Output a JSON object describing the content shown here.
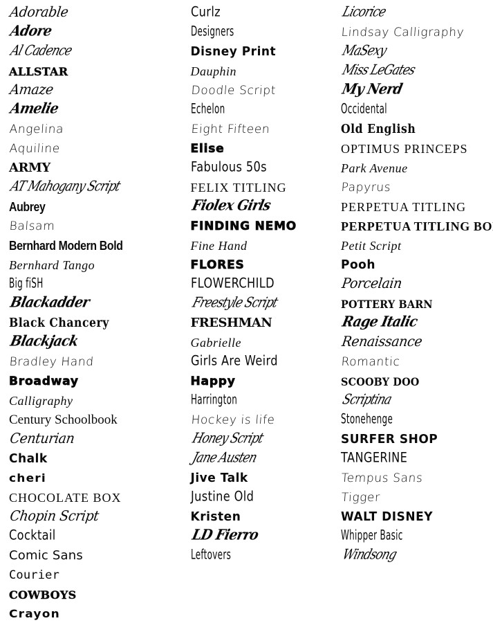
{
  "document": {
    "type": "font-specimen-sheet",
    "background_color": "#ffffff",
    "text_color": "#000000",
    "column_count": 3
  },
  "columns": [
    {
      "name": "column-1",
      "samples": [
        {
          "label": "Adorable",
          "style": "s-script"
        },
        {
          "label": "Adore",
          "style": "s-swash"
        },
        {
          "label": "Al Cadence",
          "style": "s-signature"
        },
        {
          "label": "ALLSTAR",
          "style": "s-western"
        },
        {
          "label": "Amaze",
          "style": "s-script"
        },
        {
          "label": "Amelie",
          "style": "s-swash"
        },
        {
          "label": "Angelina",
          "style": "s-hand"
        },
        {
          "label": "Aquiline",
          "style": "s-hand"
        },
        {
          "label": "ARMY",
          "style": "s-slab"
        },
        {
          "label": "AT Mahogany Script",
          "style": "s-signature"
        },
        {
          "label": "Aubrey",
          "style": "s-poster"
        },
        {
          "label": "Balsam",
          "style": "s-hand"
        },
        {
          "label": "Bernhard Modern Bold",
          "style": "s-poster"
        },
        {
          "label": "Bernhard Tango",
          "style": "s-thinitalic"
        },
        {
          "label": "Big fiSH",
          "style": "s-narrow"
        },
        {
          "label": "Blackadder",
          "style": "s-swash"
        },
        {
          "label": "Black Chancery",
          "style": "s-blackletter"
        },
        {
          "label": "Blackjack",
          "style": "s-swash"
        },
        {
          "label": "Bradley Hand",
          "style": "s-hand"
        },
        {
          "label": "Broadway",
          "style": "s-fat"
        },
        {
          "label": "Calligraphy",
          "style": "s-thinitalic"
        },
        {
          "label": "Century Schoolbook",
          "style": "s-serif"
        },
        {
          "label": "Centurian",
          "style": "s-script"
        },
        {
          "label": "Chalk",
          "style": "s-marker"
        },
        {
          "label": "cheri",
          "style": "s-crayon"
        },
        {
          "label": "Chocolate Box",
          "style": "s-titling"
        },
        {
          "label": "Chopin Script",
          "style": "s-script"
        },
        {
          "label": "Cocktail",
          "style": "s-whimsy"
        },
        {
          "label": "Comic Sans",
          "style": "s-sans"
        },
        {
          "label": "Courier",
          "style": "s-mono"
        },
        {
          "label": "COWBOYS",
          "style": "s-western"
        },
        {
          "label": "Crayon",
          "style": "s-crayon"
        }
      ]
    },
    {
      "name": "column-2",
      "samples": [
        {
          "label": "Curlz",
          "style": "s-whimsy"
        },
        {
          "label": "Designers",
          "style": "s-narrow"
        },
        {
          "label": "Disney Print",
          "style": "s-marker"
        },
        {
          "label": "Dauphin",
          "style": "s-thinitalic"
        },
        {
          "label": "Doodle Script",
          "style": "s-hand"
        },
        {
          "label": "Echelon",
          "style": "s-narrow"
        },
        {
          "label": "Eight Fifteen",
          "style": "s-hand"
        },
        {
          "label": "Elise",
          "style": "s-fat"
        },
        {
          "label": "Fabulous 50s",
          "style": "s-whimsy"
        },
        {
          "label": "FELIX TITLING",
          "style": "s-titling"
        },
        {
          "label": "Fiolex Girls",
          "style": "s-swash"
        },
        {
          "label": "FINDING NEMO",
          "style": "s-fat"
        },
        {
          "label": "Fine Hand",
          "style": "s-thinitalic"
        },
        {
          "label": "FLORES",
          "style": "s-fat"
        },
        {
          "label": "FLOWERCHILD",
          "style": "s-whimsy"
        },
        {
          "label": "Freestyle Script",
          "style": "s-signature"
        },
        {
          "label": "FRESHMAN",
          "style": "s-slab"
        },
        {
          "label": "Gabrielle",
          "style": "s-thinitalic"
        },
        {
          "label": "Girls Are Weird",
          "style": "s-whimsy"
        },
        {
          "label": "Happy",
          "style": "s-fat"
        },
        {
          "label": "Harrington",
          "style": "s-narrow"
        },
        {
          "label": "Hockey is life",
          "style": "s-hand"
        },
        {
          "label": "Honey Script",
          "style": "s-signature"
        },
        {
          "label": "Jane Austen",
          "style": "s-signature"
        },
        {
          "label": "Jive Talk",
          "style": "s-marker"
        },
        {
          "label": "Justine Old",
          "style": "s-whimsy"
        },
        {
          "label": "Kristen",
          "style": "s-marker"
        },
        {
          "label": "LD Fierro",
          "style": "s-swash"
        },
        {
          "label": "Leftovers",
          "style": "s-narrow"
        }
      ]
    },
    {
      "name": "column-3",
      "samples": [
        {
          "label": "Licorice",
          "style": "s-signature"
        },
        {
          "label": "Lindsay Calligraphy",
          "style": "s-hand"
        },
        {
          "label": "MaSexy",
          "style": "s-signature"
        },
        {
          "label": "Miss LeGates",
          "style": "s-signature"
        },
        {
          "label": "My Nerd",
          "style": "s-swash"
        },
        {
          "label": "Occidental",
          "style": "s-narrow"
        },
        {
          "label": "Old English",
          "style": "s-blackletter"
        },
        {
          "label": "OPTIMUS PRINCEPS",
          "style": "s-titling"
        },
        {
          "label": "Park Avenue",
          "style": "s-thinitalic"
        },
        {
          "label": "Papyrus",
          "style": "s-hand"
        },
        {
          "label": "PERPETUA TITLING",
          "style": "s-titling"
        },
        {
          "label": "PERPETUA TITLING BOLD",
          "style": "s-titling-bold"
        },
        {
          "label": "Petit Script",
          "style": "s-thinitalic"
        },
        {
          "label": "Pooh",
          "style": "s-marker"
        },
        {
          "label": "Porcelain",
          "style": "s-script"
        },
        {
          "label": "POTTERY BARN",
          "style": "s-smallcaps"
        },
        {
          "label": "Rage Italic",
          "style": "s-swash"
        },
        {
          "label": "Renaissance",
          "style": "s-script"
        },
        {
          "label": "Romantic",
          "style": "s-hand"
        },
        {
          "label": "SCOOBY DOO",
          "style": "s-smallcaps"
        },
        {
          "label": "Scriptina",
          "style": "s-signature"
        },
        {
          "label": "Stonehenge",
          "style": "s-narrow"
        },
        {
          "label": "SURFER SHOP",
          "style": "s-marker"
        },
        {
          "label": "TANGERINE",
          "style": "s-whimsy"
        },
        {
          "label": "Tempus Sans",
          "style": "s-hand"
        },
        {
          "label": "Tigger",
          "style": "s-hand"
        },
        {
          "label": "WALT DISNEY",
          "style": "s-marker"
        },
        {
          "label": "Whipper Basic",
          "style": "s-narrow"
        },
        {
          "label": "Windsong",
          "style": "s-signature"
        }
      ]
    }
  ]
}
